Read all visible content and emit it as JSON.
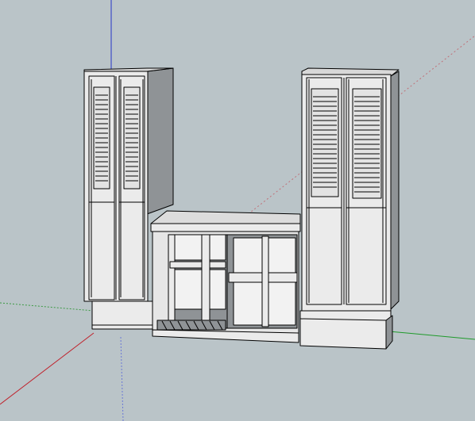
{
  "viewport": {
    "background": "#bac4c8",
    "axis_colors": {
      "red": "#c0202a",
      "green": "#1e9a2a",
      "blue": "#2433c8"
    }
  },
  "model": {
    "face_color": "#ebebeb",
    "shadow_color": "#8f9396",
    "edge_color": "#000000"
  }
}
